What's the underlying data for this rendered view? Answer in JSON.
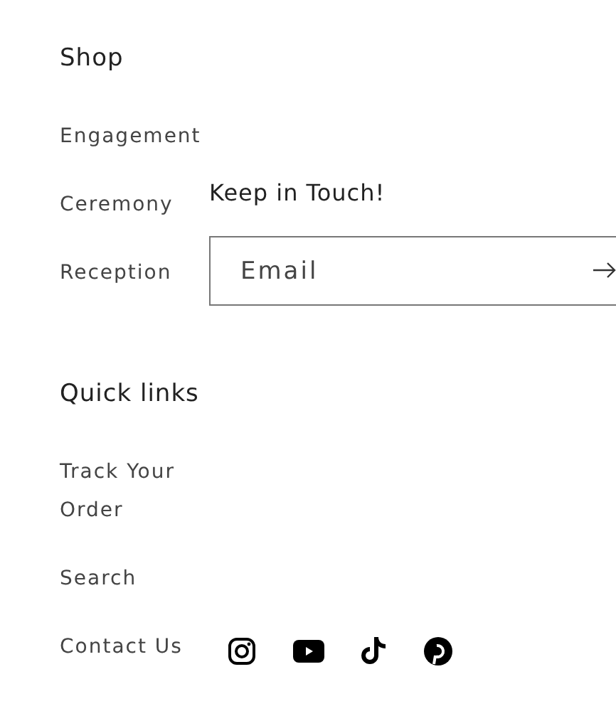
{
  "shop": {
    "heading": "Shop",
    "links": [
      "Engagement",
      "Ceremony",
      "Reception"
    ]
  },
  "quick_links": {
    "heading": "Quick links",
    "links": [
      "Track Your Order",
      "Search",
      "Contact Us"
    ]
  },
  "newsletter": {
    "heading": "Keep in Touch!",
    "email": {
      "placeholder": "Email"
    }
  },
  "social": [
    {
      "kind": "instagram"
    },
    {
      "kind": "youtube"
    },
    {
      "kind": "tiktok"
    },
    {
      "kind": "pinterest"
    }
  ]
}
